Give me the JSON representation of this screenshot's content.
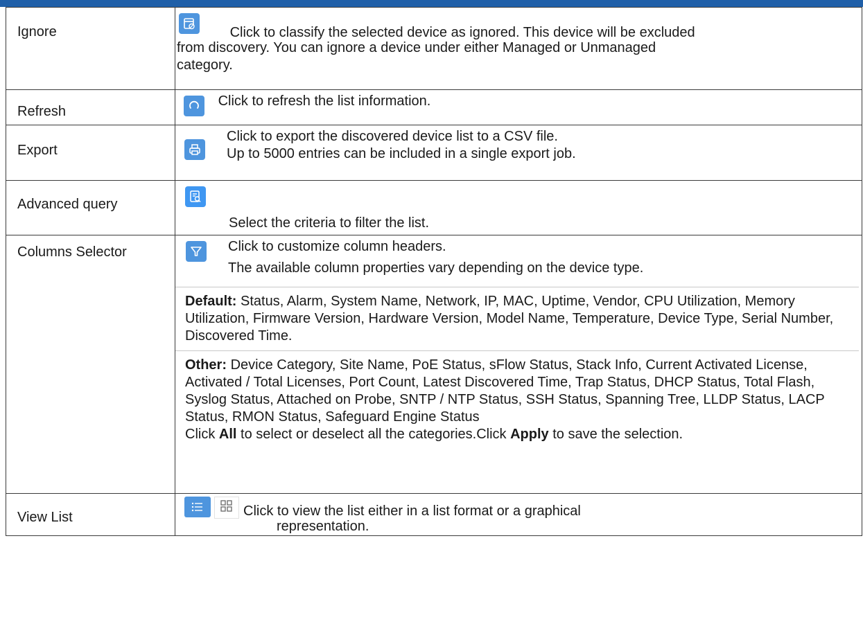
{
  "colors": {
    "accent": "#4e95de",
    "topbar": "#1f5fa8",
    "border": "#3a3a3a"
  },
  "rows": {
    "ignore": {
      "name": "Ignore",
      "icon": "ignore-icon",
      "line1": "Click to classify the selected device as ignored. This device will be excluded",
      "line2": "from discovery. You can ignore a device under either Managed or Unmanaged",
      "line3": "category."
    },
    "refresh": {
      "name": "Refresh",
      "icon": "refresh-icon",
      "text": "Click to refresh the list information."
    },
    "export": {
      "name": "Export",
      "icon": "print-icon",
      "line1": "Click to export the discovered device list to a CSV file.",
      "line2": "Up to 5000 entries can be included in a single export job."
    },
    "advanced": {
      "name": "Advanced query",
      "icon": "query-icon",
      "text": "Select the criteria to filter the list."
    },
    "columns": {
      "name": "Columns Selector",
      "icon": "filter-icon",
      "line1": "Click to customize column headers.",
      "line2": "The available column properties vary depending on the device type.",
      "default_label": "Default:",
      "default_text": "Status, Alarm, System Name, Network, IP, MAC, Uptime, Vendor, CPU Utilization, Memory Utilization, Firmware Version, Hardware Version, Model Name, Temperature, Device Type, Serial Number, Discovered Time.",
      "other_label": "Other:",
      "other_text": "Device Category, Site Name, PoE Status, sFlow Status, Stack Info, Current Activated License, Activated / Total Licenses, Port Count, Latest Discovered Time, Trap Status, DHCP Status, Total Flash, Syslog Status, Attached on Probe, SNTP / NTP Status, SSH Status, Spanning Tree, LLDP Status, LACP Status, RMON Status, Safeguard Engine Status",
      "final_pre": "Click ",
      "final_all": "All",
      "final_mid": " to select or deselect all the categories.Click ",
      "final_apply": "Apply",
      "final_post": " to save the selection."
    },
    "view": {
      "name": "View List",
      "icon_list": "list-view-icon",
      "icon_grid": "grid-view-icon",
      "line1": "Click to view the list either in a list format or a graphical",
      "line2": "representation."
    }
  }
}
